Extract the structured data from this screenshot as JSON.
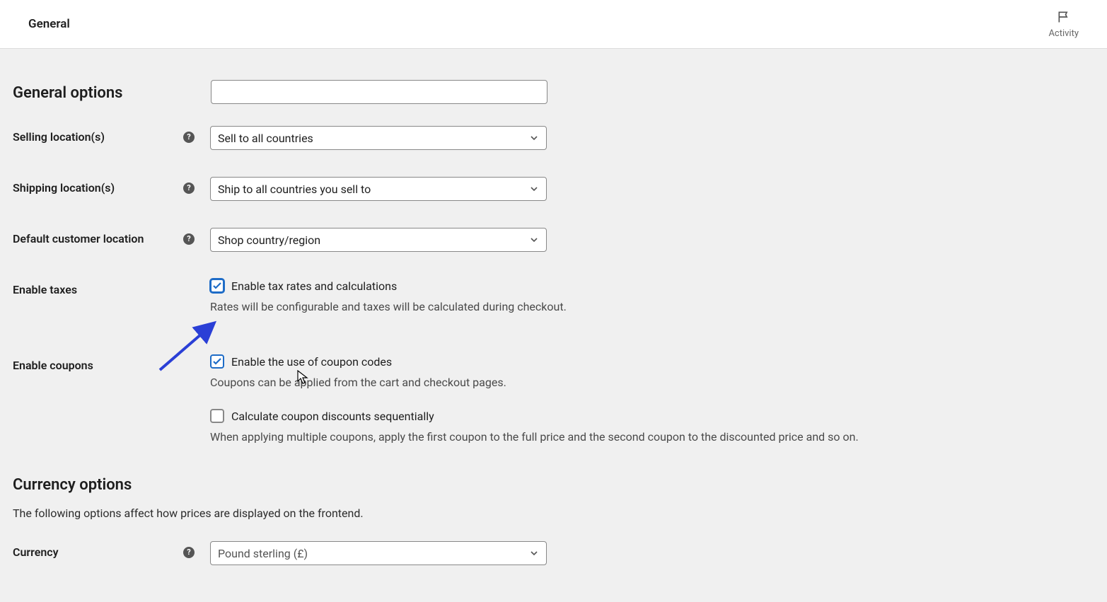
{
  "header": {
    "title": "General",
    "activity_label": "Activity"
  },
  "sections": {
    "general_options": {
      "heading": "General options",
      "fields": {
        "selling_locations": {
          "label": "Selling location(s)",
          "value": "Sell to all countries"
        },
        "shipping_locations": {
          "label": "Shipping location(s)",
          "value": "Ship to all countries you sell to"
        },
        "default_customer_location": {
          "label": "Default customer location",
          "value": "Shop country/region"
        },
        "enable_taxes": {
          "label": "Enable taxes",
          "checkbox_label": "Enable tax rates and calculations",
          "description": "Rates will be configurable and taxes will be calculated during checkout.",
          "checked": true
        },
        "enable_coupons": {
          "label": "Enable coupons",
          "checkbox1_label": "Enable the use of coupon codes",
          "description1": "Coupons can be applied from the cart and checkout pages.",
          "checkbox1_checked": true,
          "checkbox2_label": "Calculate coupon discounts sequentially",
          "description2": "When applying multiple coupons, apply the first coupon to the full price and the second coupon to the discounted price and so on.",
          "checkbox2_checked": false
        }
      }
    },
    "currency_options": {
      "heading": "Currency options",
      "description": "The following options affect how prices are displayed on the frontend.",
      "fields": {
        "currency": {
          "label": "Currency",
          "value": "Pound sterling (£)"
        }
      }
    }
  }
}
